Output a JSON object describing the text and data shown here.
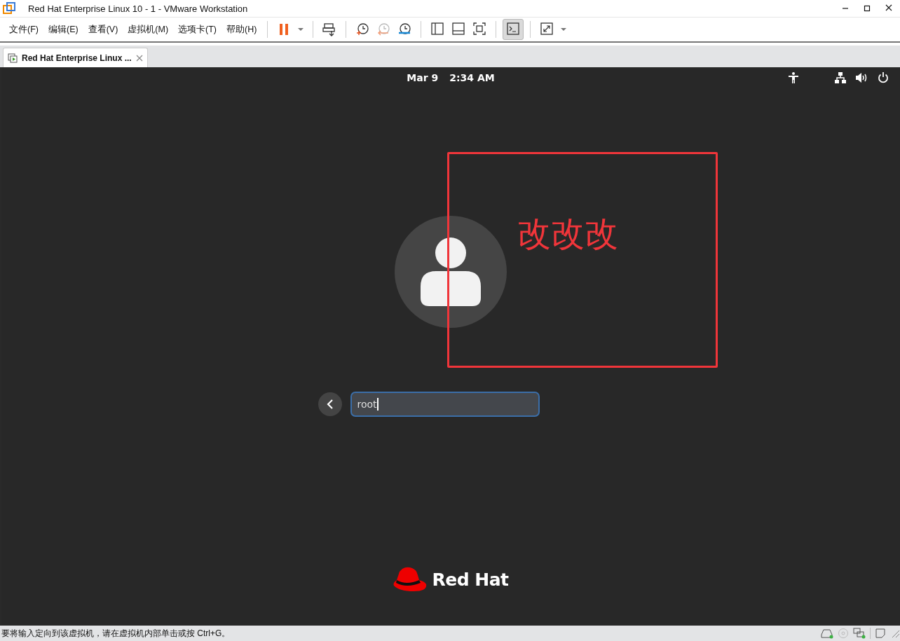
{
  "window": {
    "title": "Red Hat Enterprise Linux 10 - 1 - VMware Workstation"
  },
  "menu": [
    "文件(F)",
    "编辑(E)",
    "查看(V)",
    "虚拟机(M)",
    "选项卡(T)",
    "帮助(H)"
  ],
  "toolbar": [
    {
      "items": [
        {
          "kind": "pause",
          "pressed": false
        },
        {
          "kind": "dropdown",
          "pressed": false
        }
      ]
    },
    {
      "items": [
        {
          "kind": "send-keys",
          "pressed": false
        }
      ]
    },
    {
      "items": [
        {
          "kind": "snapshot-take",
          "pressed": false
        },
        {
          "kind": "snapshot-revert",
          "pressed": false
        },
        {
          "kind": "snapshot-manager",
          "pressed": false
        }
      ]
    },
    {
      "items": [
        {
          "kind": "view-sidebar",
          "pressed": false
        },
        {
          "kind": "view-thumbnail",
          "pressed": false
        },
        {
          "kind": "view-fit",
          "pressed": false
        }
      ]
    },
    {
      "items": [
        {
          "kind": "console",
          "pressed": true
        }
      ]
    },
    {
      "items": [
        {
          "kind": "fullscreen",
          "pressed": false
        },
        {
          "kind": "dropdown",
          "pressed": false
        }
      ]
    }
  ],
  "tabs": [
    {
      "label": "Red Hat Enterprise Linux ...",
      "selected": true
    }
  ],
  "guest": {
    "date": "Mar 9",
    "time": "2:34 AM",
    "username_field": {
      "value": "root"
    },
    "logo_text": "Red Hat"
  },
  "annotation": {
    "text": "改改改",
    "color": "#f0353a"
  },
  "status_bar": {
    "message": "要将输入定向到该虚拟机，请在虚拟机内部单击或按 Ctrl+G。"
  }
}
